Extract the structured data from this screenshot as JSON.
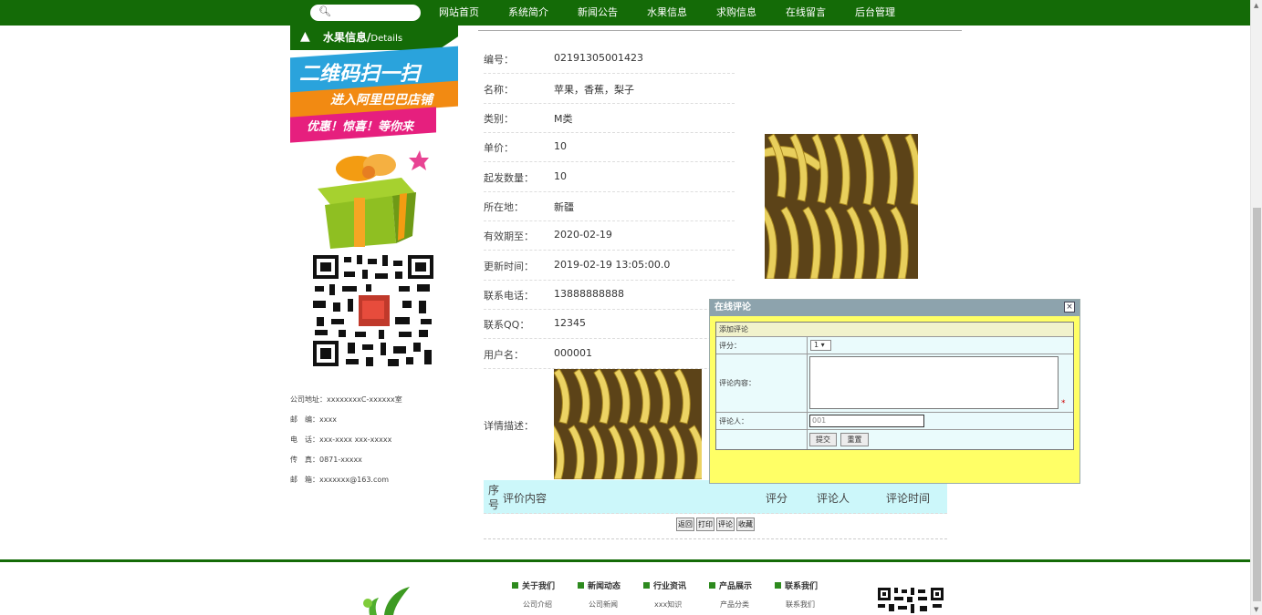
{
  "nav": {
    "items": [
      "网站首页",
      "系统简介",
      "新闻公告",
      "水果信息",
      "求购信息",
      "在线留言",
      "后台管理"
    ]
  },
  "sidebar": {
    "title": "水果信息/",
    "title_small": "Details",
    "promo": {
      "line1": "二维码扫一扫",
      "line2": "进入阿里巴巴店铺",
      "line3": "优惠！惊喜！等你来"
    },
    "contact": [
      "公司地址：xxxxxxxxC-xxxxxx室",
      "邮　编：xxxx",
      "电　话：xxx-xxxx xxx-xxxxx",
      "传　真：0871-xxxxx",
      "邮　箱：xxxxxxx@163.com"
    ]
  },
  "detail": {
    "rows": [
      {
        "label": "编号：",
        "value": "02191305001423"
      },
      {
        "label": "名称：",
        "value": "苹果，香蕉，梨子"
      },
      {
        "label": "类别：",
        "value": "M类"
      },
      {
        "label": "单价：",
        "value": "10"
      },
      {
        "label": "起发数量：",
        "value": "10"
      },
      {
        "label": "所在地：",
        "value": "新疆"
      },
      {
        "label": "有效期至：",
        "value": "2020-02-19"
      },
      {
        "label": "更新时间：",
        "value": "2019-02-19 13:05:00.0"
      },
      {
        "label": "联系电话：",
        "value": "13888888888"
      },
      {
        "label": "联系QQ：",
        "value": "12345"
      },
      {
        "label": "用户名：",
        "value": "000001"
      }
    ],
    "desc_label": "详情描述："
  },
  "comments": {
    "headers": {
      "seq": "序号",
      "content": "评价内容",
      "score": "评分",
      "user": "评论人",
      "time": "评论时间"
    },
    "buttons": [
      "返回",
      "打印",
      "评论",
      "收藏"
    ]
  },
  "modal": {
    "title": "在线评论",
    "close": "×",
    "section": "添加评论",
    "score_label": "评分：",
    "score_value": "1 ▾",
    "content_label": "评论内容：",
    "content_required": "*",
    "user_label": "评论人：",
    "user_value": "001",
    "submit": "提交",
    "reset": "重置"
  },
  "footer": {
    "columns": [
      {
        "head": "关于我们",
        "sub": "公司介绍"
      },
      {
        "head": "新闻动态",
        "sub": "公司新闻"
      },
      {
        "head": "行业资讯",
        "sub": "xxx知识"
      },
      {
        "head": "产品展示",
        "sub": "产品分类"
      },
      {
        "head": "联系我们",
        "sub": "联系我们"
      }
    ]
  },
  "colors": {
    "brand_green": "#146b07",
    "table_header": "#ccf7fa",
    "modal_bg": "#ffff66"
  }
}
